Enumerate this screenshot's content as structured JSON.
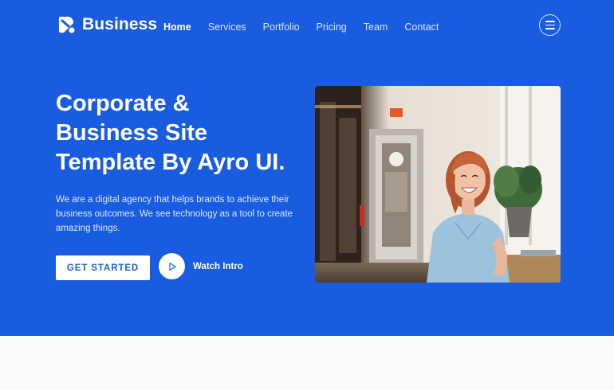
{
  "brand": {
    "name": "Business",
    "icon": "ayro-logo-mark"
  },
  "nav": {
    "items": [
      {
        "label": "Home",
        "active": true
      },
      {
        "label": "Services",
        "active": false
      },
      {
        "label": "Portfolio",
        "active": false
      },
      {
        "label": "Pricing",
        "active": false
      },
      {
        "label": "Team",
        "active": false
      },
      {
        "label": "Contact",
        "active": false
      }
    ],
    "menu_icon": "hamburger-icon"
  },
  "hero": {
    "title_lines": [
      "Corporate &",
      "Business Site",
      "Template By Ayro UI."
    ],
    "text_lines": [
      "We are a digital agency that helps brands to achieve their",
      "business outcomes. We see technology as a tool to create",
      "amazing things."
    ],
    "cta_label": "GET STARTED",
    "watch_label": "Watch Intro",
    "watch_icon": "play-icon",
    "image": "smiling-woman-in-office-photo"
  },
  "colors": {
    "primary": "#1a5ce0",
    "white": "#ffffff",
    "below_section": "#f9f9fa"
  }
}
